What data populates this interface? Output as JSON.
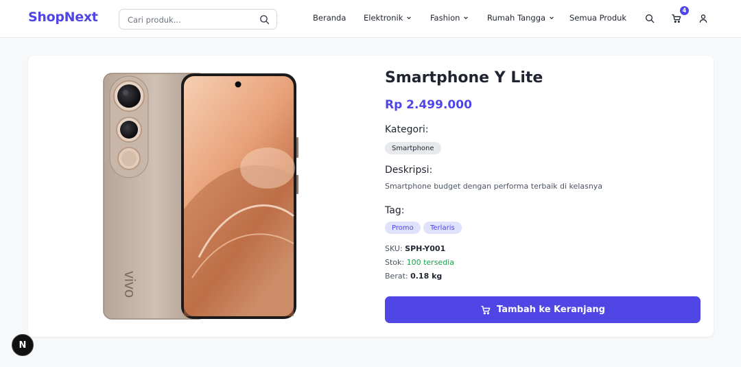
{
  "brand": {
    "name": "ShopNext",
    "color": "#4f46e5"
  },
  "search": {
    "placeholder": "Cari produk...",
    "value": ""
  },
  "nav": {
    "items": [
      {
        "label": "Beranda",
        "has_dropdown": false
      },
      {
        "label": "Elektronik",
        "has_dropdown": true
      },
      {
        "label": "Fashion",
        "has_dropdown": true
      },
      {
        "label": "Rumah Tangga",
        "has_dropdown": true
      },
      {
        "label": "Semua Produk",
        "has_dropdown": false
      }
    ],
    "icons": [
      "search-icon",
      "cart-icon",
      "user-icon"
    ],
    "cart_count": "4"
  },
  "product": {
    "title": "Smartphone Y Lite",
    "price": "Rp 2.499.000",
    "category_label": "Kategori:",
    "category": "Smartphone",
    "description_label": "Deskripsi:",
    "description": "Smartphone budget dengan performa terbaik di kelasnya",
    "tags_label": "Tag:",
    "tags": [
      "Promo",
      "Terlaris"
    ],
    "sku_label": "SKU:",
    "sku": "SPH-Y001",
    "stock_label": "Stok:",
    "stock": "100 tersedia",
    "weight_label": "Berat:",
    "weight": "0.18 kg",
    "image_brand_text": "vivo",
    "add_to_cart": "Tambah ke Keranjang"
  },
  "dev_badge": {
    "label": "N"
  },
  "colors": {
    "accent": "#4f46e5",
    "stock_green": "#16a34a",
    "tag_bg": "#e0e1fb",
    "chip_gray": "#e8e9ec"
  }
}
